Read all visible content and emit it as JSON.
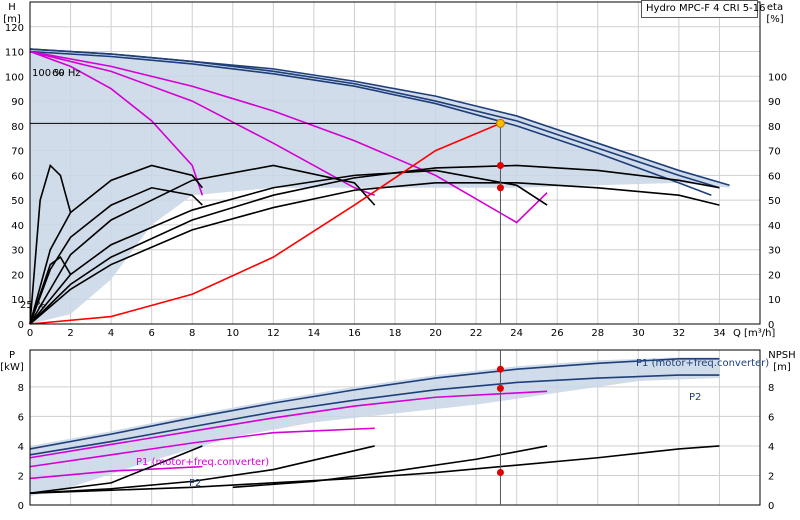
{
  "title": "Hydro MPC-F 4 CRI 5-16",
  "chart_data": [
    {
      "type": "line",
      "name": "head",
      "ylabel": "H",
      "yunit": "[m]",
      "y2label": "eta",
      "y2unit": "[%]",
      "xlabel": "Q [m³/h]",
      "xlim": [
        0,
        36
      ],
      "ylim": [
        0,
        130
      ],
      "y2lim": [
        0,
        130
      ],
      "x_ticks": [
        0,
        2,
        4,
        6,
        8,
        10,
        12,
        14,
        16,
        18,
        20,
        22,
        24,
        26,
        28,
        30,
        32,
        34
      ],
      "y_ticks": [
        0,
        10,
        20,
        30,
        40,
        50,
        60,
        70,
        80,
        90,
        100,
        110,
        120
      ],
      "y2_ticks": [
        0,
        10,
        20,
        30,
        40,
        50,
        60,
        70,
        80,
        90,
        100
      ],
      "annotations": [
        "100 %",
        "60 Hz",
        "25 %"
      ],
      "duty_point": {
        "x": 23.2,
        "y": 81
      },
      "setpoint_line": 81,
      "series": [
        {
          "color": "#1f3f7a",
          "x": [
            0,
            4,
            8,
            12,
            16,
            20,
            24,
            28,
            32,
            33.6
          ],
          "y": [
            110,
            108,
            105,
            101,
            96,
            89,
            80,
            69,
            57,
            52
          ]
        },
        {
          "color": "#1f3f7a",
          "x": [
            0,
            4,
            8,
            12,
            16,
            20,
            24,
            28,
            32,
            34
          ],
          "y": [
            111,
            109,
            106,
            102,
            97,
            90,
            82,
            71,
            60,
            55
          ]
        },
        {
          "color": "#1f3f7a",
          "x": [
            0,
            4,
            8,
            12,
            16,
            20,
            24,
            28,
            32,
            34.5
          ],
          "y": [
            111,
            109,
            106,
            103,
            98,
            92,
            84,
            73,
            62,
            56
          ]
        },
        {
          "color": "#d400d4",
          "x": [
            0,
            4,
            8,
            12,
            16,
            20,
            24,
            25.5
          ],
          "y": [
            110,
            104,
            96,
            86,
            74,
            60,
            41,
            53
          ]
        },
        {
          "color": "#d400d4",
          "x": [
            0,
            4,
            8,
            12,
            16,
            17
          ],
          "y": [
            110,
            102,
            90,
            73,
            55,
            52
          ]
        },
        {
          "color": "#d400d4",
          "x": [
            0,
            2,
            4,
            6,
            8,
            8.5
          ],
          "y": [
            110,
            104,
            95,
            82,
            64,
            52
          ]
        },
        {
          "color": "#000000",
          "x": [
            0,
            1,
            2,
            4,
            6,
            8,
            8.5
          ],
          "y": [
            0,
            30,
            45,
            58,
            64,
            60,
            55
          ]
        },
        {
          "color": "#000000",
          "x": [
            0,
            1,
            2,
            4,
            6,
            8,
            8.5
          ],
          "y": [
            0,
            22,
            35,
            48,
            55,
            52,
            48
          ]
        },
        {
          "color": "#000000",
          "x": [
            0,
            2,
            4,
            8,
            12,
            16,
            17
          ],
          "y": [
            0,
            28,
            42,
            58,
            64,
            57,
            48
          ]
        },
        {
          "color": "#000000",
          "x": [
            0,
            2,
            4,
            8,
            12,
            16,
            20,
            24,
            25.5
          ],
          "y": [
            0,
            20,
            32,
            46,
            55,
            60,
            62,
            56,
            48
          ]
        },
        {
          "color": "#000000",
          "x": [
            0,
            2,
            4,
            8,
            12,
            16,
            20,
            24,
            28,
            32,
            34
          ],
          "y": [
            0,
            14,
            24,
            38,
            47,
            54,
            57,
            57,
            55,
            52,
            48
          ]
        },
        {
          "color": "#000000",
          "x": [
            0,
            2,
            4,
            8,
            12,
            16,
            20,
            24,
            28,
            32,
            34
          ],
          "y": [
            0,
            16,
            27,
            42,
            52,
            59,
            63,
            64,
            62,
            58,
            55
          ]
        },
        {
          "color": "#000000",
          "x": [
            0,
            0.5,
            1,
            1.5,
            2
          ],
          "y": [
            0,
            50,
            64,
            60,
            45
          ]
        },
        {
          "color": "#000000",
          "x": [
            0,
            1,
            1.5,
            2
          ],
          "y": [
            0,
            24,
            27,
            20
          ]
        },
        {
          "color": "#ff0000",
          "x": [
            0,
            4,
            8,
            12,
            16,
            20,
            23.2
          ],
          "y": [
            0,
            3,
            12,
            27,
            48,
            70,
            81
          ]
        }
      ]
    },
    {
      "type": "line",
      "name": "power",
      "ylabel": "P",
      "yunit": "[kW]",
      "y2label": "NPSH",
      "y2unit": "[m]",
      "xlim": [
        0,
        36
      ],
      "ylim": [
        0,
        10.5
      ],
      "y_ticks": [
        0,
        2,
        4,
        6,
        8
      ],
      "y2_ticks": [
        0,
        2,
        4,
        6,
        8
      ],
      "labels": [
        "P1 (motor+freq.converter)",
        "P2",
        "P1 (motor+freq.converter)",
        "P2"
      ],
      "series": [
        {
          "color": "#1f3f7a",
          "x": [
            0,
            4,
            8,
            12,
            16,
            20,
            24,
            28,
            32,
            34
          ],
          "y": [
            3.8,
            4.8,
            5.9,
            6.9,
            7.8,
            8.6,
            9.2,
            9.6,
            9.9,
            9.9
          ]
        },
        {
          "color": "#1f3f7a",
          "x": [
            0,
            4,
            8,
            12,
            16,
            20,
            24,
            28,
            32,
            34
          ],
          "y": [
            3.4,
            4.3,
            5.3,
            6.3,
            7.1,
            7.8,
            8.3,
            8.6,
            8.8,
            8.8
          ]
        },
        {
          "color": "#d400d4",
          "x": [
            0,
            4,
            8,
            12,
            16,
            20,
            25.5
          ],
          "y": [
            3.2,
            4.1,
            5.0,
            5.9,
            6.7,
            7.3,
            7.7
          ]
        },
        {
          "color": "#d400d4",
          "x": [
            0,
            4,
            8,
            12,
            17
          ],
          "y": [
            2.6,
            3.4,
            4.2,
            4.9,
            5.2
          ]
        },
        {
          "color": "#d400d4",
          "x": [
            0,
            4,
            8.5
          ],
          "y": [
            1.8,
            2.3,
            2.6
          ]
        },
        {
          "color": "#000000",
          "x": [
            0,
            4,
            8,
            12,
            16,
            20,
            24,
            28,
            32,
            34
          ],
          "y": [
            0.8,
            1.0,
            1.2,
            1.5,
            1.8,
            2.2,
            2.7,
            3.2,
            3.8,
            4.0
          ]
        },
        {
          "color": "#000000",
          "x": [
            0,
            4,
            8,
            12,
            17
          ],
          "y": [
            0.8,
            1.1,
            1.6,
            2.4,
            4.0
          ]
        },
        {
          "color": "#000000",
          "x": [
            0,
            4,
            8.5
          ],
          "y": [
            0.8,
            1.5,
            4.0
          ]
        },
        {
          "color": "#000000",
          "x": [
            10,
            14,
            18,
            22,
            25.5
          ],
          "y": [
            1.2,
            1.6,
            2.3,
            3.1,
            4.0
          ]
        }
      ],
      "duty_points": [
        9.2,
        7.9,
        2.2
      ]
    }
  ]
}
